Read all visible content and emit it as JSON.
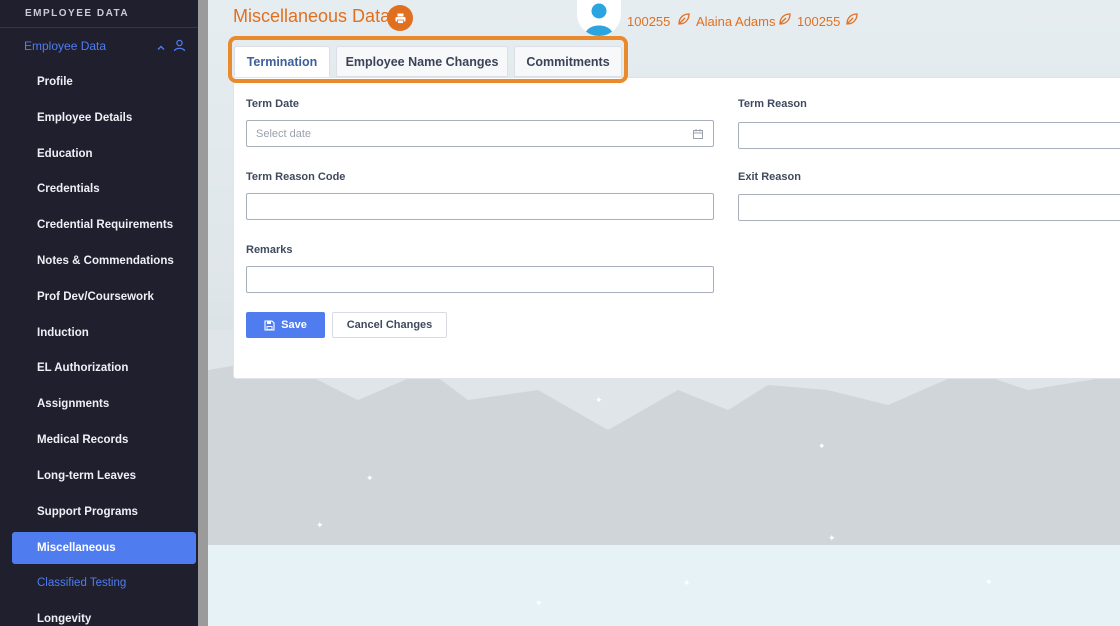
{
  "sidebar": {
    "header": "EMPLOYEE DATA",
    "section_label": "Employee Data",
    "items": [
      {
        "label": "Profile"
      },
      {
        "label": "Employee Details"
      },
      {
        "label": "Education"
      },
      {
        "label": "Credentials"
      },
      {
        "label": "Credential Requirements"
      },
      {
        "label": "Notes & Commendations"
      },
      {
        "label": "Prof Dev/Coursework"
      },
      {
        "label": "Induction"
      },
      {
        "label": "EL Authorization"
      },
      {
        "label": "Assignments"
      },
      {
        "label": "Medical Records"
      },
      {
        "label": "Long-term Leaves"
      },
      {
        "label": "Support Programs"
      },
      {
        "label": "Miscellaneous",
        "active": true
      },
      {
        "label": "Classified Testing"
      },
      {
        "label": "Longevity"
      }
    ]
  },
  "header": {
    "title": "Miscellaneous Data",
    "employee_id_1": "100255",
    "employee_name": "Alaina Adams",
    "employee_id_2": "100255"
  },
  "tabs": [
    {
      "label": "Termination",
      "active": true
    },
    {
      "label": "Employee Name Changes"
    },
    {
      "label": "Commitments"
    }
  ],
  "form": {
    "term_date_label": "Term Date",
    "term_date_placeholder": "Select date",
    "term_reason_label": "Term Reason",
    "term_reason_code_label": "Term Reason Code",
    "exit_reason_label": "Exit Reason",
    "remarks_label": "Remarks",
    "save_label": "Save",
    "cancel_label": "Cancel Changes"
  },
  "colors": {
    "accent": "#4f7df0",
    "brand_orange": "#e0701f",
    "highlight": "#e98a2c",
    "sidebar_bg": "#1f1f2e"
  },
  "icons": [
    "print-icon",
    "user-icon",
    "chevron-up-icon",
    "leaf-icon",
    "calendar-icon",
    "save-icon"
  ]
}
